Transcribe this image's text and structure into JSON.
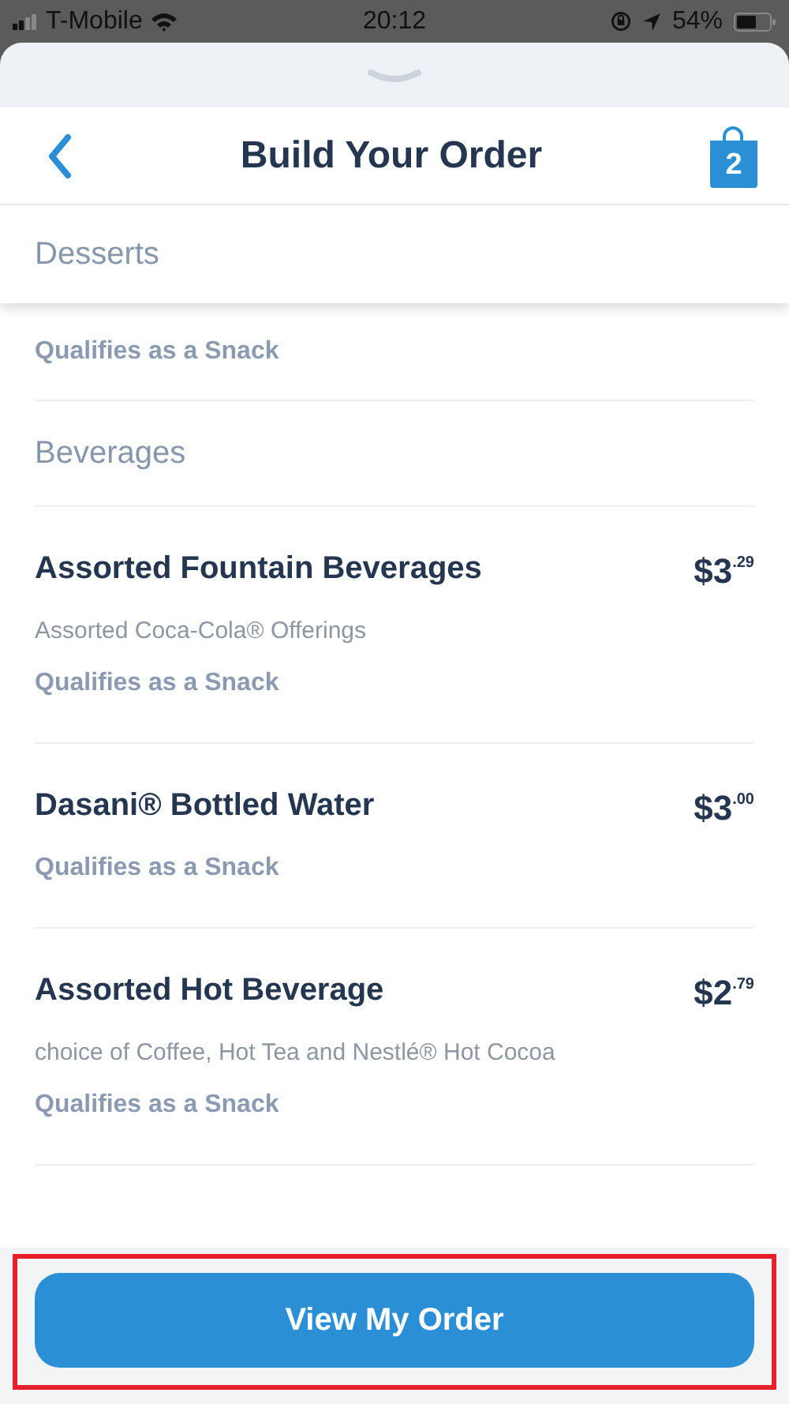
{
  "status_bar": {
    "carrier": "T-Mobile",
    "time": "20:12",
    "battery": "54%"
  },
  "header": {
    "title": "Build Your Order",
    "cart_count": "2"
  },
  "sticky_section": "Desserts",
  "partial_item": {
    "note": "Qualifies as a Snack"
  },
  "section": "Beverages",
  "items": [
    {
      "name": "Assorted Fountain Beverages",
      "price": "$3$^{.29}$",
      "description": "Assorted Coca-Cola® Offerings",
      "note": "Qualifies as a Snack"
    },
    {
      "name": "Dasani® Bottled Water",
      "price": "$3$^{.00}$",
      "note": "Qualifies as a Snack"
    },
    {
      "name": "Assorted Hot Beverage",
      "price": "$2$^{.79}$",
      "description": "choice of Coffee, Hot Tea and Nestlé® Hot Cocoa",
      "note": "Qualifies as a Snack"
    }
  ],
  "footer_button": "View My Order"
}
